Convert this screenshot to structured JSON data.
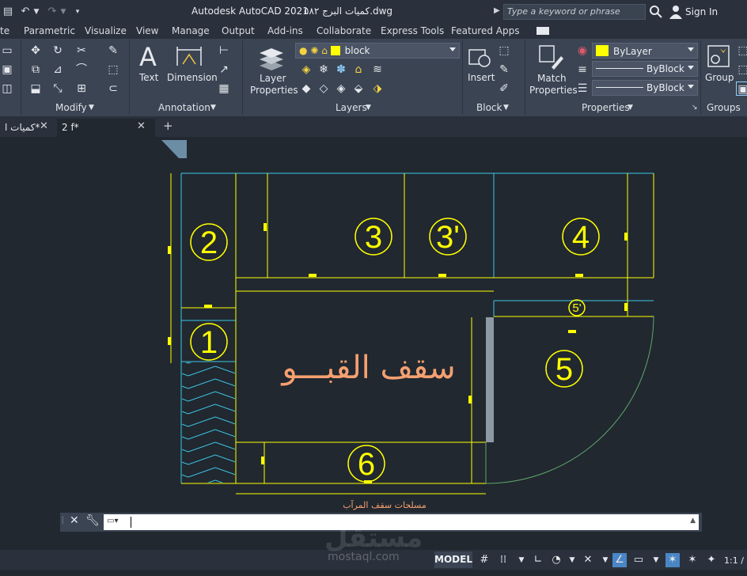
{
  "title": {
    "app": "Autodesk AutoCAD 2021",
    "filename": "كميات البرج ٥٨٢.dwg"
  },
  "search": {
    "placeholder": "Type a keyword or phrase"
  },
  "account": {
    "signin": "Sign In"
  },
  "menu": [
    "te",
    "Parametric",
    "Visualize",
    "View",
    "Manage",
    "Output",
    "Add-ins",
    "Collaborate",
    "Express Tools",
    "Featured Apps"
  ],
  "ribbon": {
    "modify_label": "Modify",
    "annotation_label": "Annotation",
    "text_label": "Text",
    "dimension_label": "Dimension",
    "layer_props": [
      "Layer",
      "Properties"
    ],
    "layers_label": "Layers",
    "layer_value": "block",
    "insert_label": "Insert",
    "block_label": "Block",
    "match_props": [
      "Match",
      "Properties"
    ],
    "properties_label": "Properties",
    "color_value": "ByLayer",
    "linetype_value": "ByBlock",
    "lineweight_value": "ByBlock",
    "group_label": "Group",
    "groups_label": "Groups"
  },
  "doc_tabs": [
    {
      "label": "كميات ا*"
    },
    {
      "label": "2 f*"
    }
  ],
  "drawing": {
    "room_labels": [
      "2",
      "3",
      "3'",
      "4",
      "5'",
      "1",
      "5",
      "6"
    ],
    "main_label": "سقف القبـــو",
    "footer_label": "مسلحات سقف المرآب"
  },
  "status": {
    "model": "MODEL",
    "scale": "1:1 /"
  },
  "watermark": {
    "arabic": "مستقل",
    "latin": "mostaql.com"
  },
  "colors": {
    "yellow": "#ffff00",
    "cyan": "#3cc8e6",
    "salmon": "#f6a070",
    "green": "#5fa86a",
    "bg": "#212830"
  }
}
